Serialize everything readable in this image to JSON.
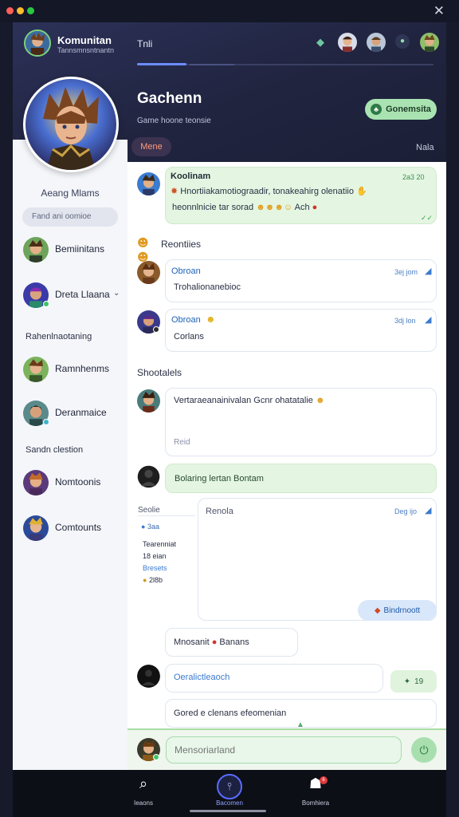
{
  "window": {
    "close_label": "✕"
  },
  "brand": {
    "name": "Komunitan",
    "sub": "Tannsmnsntnantn"
  },
  "top_tab": {
    "label": "Tnli"
  },
  "group": {
    "title": "Gachenn",
    "subtitle": "Game hoone teonsie",
    "join_label": "Gonemsita",
    "menu_label": "Mene",
    "right_label": "Nala"
  },
  "sidebar": {
    "profile_name": "Aeang Mlams",
    "search_placeholder": "Fand ani oomioe",
    "items": [
      {
        "label": "Bemiinitans"
      },
      {
        "label": "Dreta Llaana",
        "chevron": "⌄"
      },
      {
        "label": "Ramnhenms"
      },
      {
        "label": "Deranmaice"
      },
      {
        "label": "Nomtoonis"
      },
      {
        "label": "Comtounts"
      }
    ],
    "heading_1": "Rahenlnaotaning",
    "heading_2": "Sandn clestion"
  },
  "chat": {
    "msg1": {
      "name": "Koolinam",
      "time": "2a3 20",
      "line1": "Hnortiiakamotiograadir, tonakeahirg olenatiio",
      "line2": "heonnlnicie tar sorad",
      "line2_tail": "Ach",
      "ticks": "✓✓"
    },
    "section_1": "Reontiies",
    "msg2": {
      "name": "Obroan",
      "meta": "3ej jom",
      "text": "Trohalionanebioc"
    },
    "msg3": {
      "name": "Obroan",
      "meta": "3dj lon",
      "text": "Corlans"
    },
    "section_2": "Shootalels",
    "msg4": {
      "text": "Vertaraeanainivalan Gcnr ohatatalie",
      "footer": "Reid"
    },
    "msg5": {
      "text": "Bolaring lertan Bontam"
    },
    "side_panel": {
      "title": "Seolie",
      "stat1": "3aa",
      "title2": "Tearenniat",
      "stat2": "18 eian",
      "stat3": "Bresets",
      "stat4": "2l8b"
    },
    "msg6": {
      "title": "Renola",
      "meta": "Deg ijo",
      "btn": "Bindrnoott"
    },
    "msg7": {
      "text": "Mnosanit",
      "tail": "Banans"
    },
    "msg8": {
      "text": "Oeralictleaoch",
      "pill": "19"
    },
    "msg9": {
      "text": "Gored e clenans efeomenian"
    }
  },
  "input": {
    "placeholder": "Mensoriarland"
  },
  "nav": [
    {
      "label": "Ieaons",
      "icon": "search-icon"
    },
    {
      "label": "Bacomen",
      "icon": "people-icon"
    },
    {
      "label": "Bomhiera",
      "icon": "profile-icon",
      "badge": "6"
    }
  ]
}
